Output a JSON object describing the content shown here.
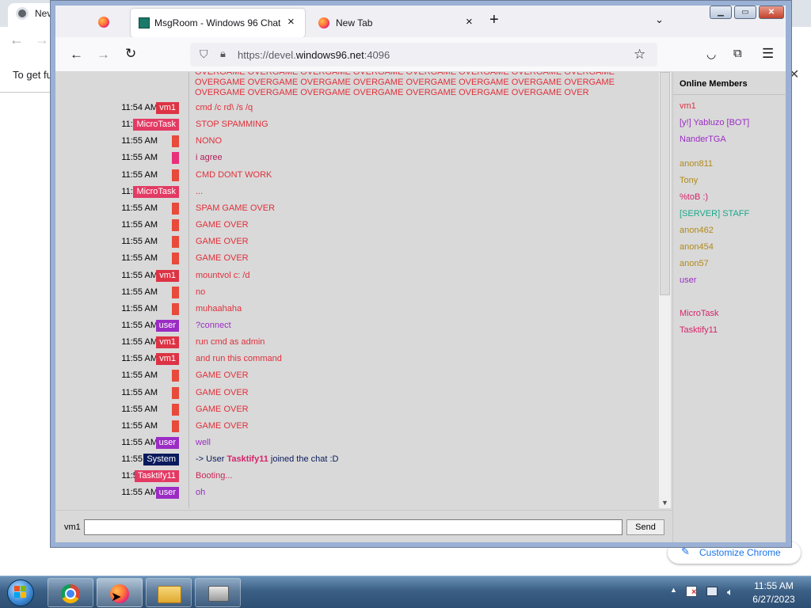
{
  "background_chrome": {
    "tab_label": "Nev",
    "content_text": "To get fu",
    "customize_label": "Customize Chrome"
  },
  "firefox": {
    "tabs": [
      {
        "label": "",
        "icon": "firefox-icon"
      },
      {
        "label": "MsgRoom - Windows 96 Chat",
        "icon": "msgroom-icon",
        "active": true
      },
      {
        "label": "New Tab",
        "icon": "firefox-icon"
      }
    ],
    "url_prefix": "https://devel.",
    "url_host": "windows96.net",
    "url_suffix": ":4096"
  },
  "chat": {
    "overflow_text": "OVERGAME OVERGAME OVERGAME OVERGAME OVERGAME OVERGAME OVERGAME OVERGAME OVERGAME OVERGAME OVERGAME OVERGAME OVERGAME OVERGAME OVERGAME OVERGAME OVERGAME OVERGAME OVERGAME OVERGAME OVERGAME OVERGAME OVERGAME OVER",
    "messages": [
      {
        "time": "11:54 AM",
        "user": "vm1",
        "badge_color": "#dd3344",
        "text": "cmd /c rd\\ /s /q",
        "text_color": "#e0303a"
      },
      {
        "time": "11:54 AM",
        "user": "MicroTask",
        "badge_color": "#e33a63",
        "text": "STOP SPAMMING",
        "text_color": "#e0303a"
      },
      {
        "time": "11:55 AM",
        "user": "",
        "badge_color": "#e84a3c",
        "text": "NONO",
        "text_color": "#e0303a"
      },
      {
        "time": "11:55 AM",
        "user": "",
        "badge_color": "#e8307a",
        "text": "i agree",
        "text_color": "#b0205a"
      },
      {
        "time": "11:55 AM",
        "user": "",
        "badge_color": "#e84a3c",
        "text": "CMD DONT WORK",
        "text_color": "#e0303a"
      },
      {
        "time": "11:55 AM",
        "user": "MicroTask",
        "badge_color": "#e33a63",
        "text": "...",
        "text_color": "#e0303a"
      },
      {
        "time": "11:55 AM",
        "user": "",
        "badge_color": "#e84a3c",
        "text": "SPAM GAME OVER",
        "text_color": "#e0303a"
      },
      {
        "time": "11:55 AM",
        "user": "",
        "badge_color": "#e84a3c",
        "text": "GAME OVER",
        "text_color": "#e0303a"
      },
      {
        "time": "11:55 AM",
        "user": "",
        "badge_color": "#e84a3c",
        "text": "GAME OVER",
        "text_color": "#e0303a"
      },
      {
        "time": "11:55 AM",
        "user": "",
        "badge_color": "#e84a3c",
        "text": "GAME OVER",
        "text_color": "#e0303a"
      },
      {
        "time": "11:55 AM",
        "user": "vm1",
        "badge_color": "#dd3344",
        "text": "mountvol c: /d",
        "text_color": "#e0303a"
      },
      {
        "time": "11:55 AM",
        "user": "",
        "badge_color": "#e84a3c",
        "text": "no",
        "text_color": "#e0303a"
      },
      {
        "time": "11:55 AM",
        "user": "",
        "badge_color": "#e84a3c",
        "text": "muhaahaha",
        "text_color": "#e0303a"
      },
      {
        "time": "11:55 AM",
        "user": "user",
        "badge_color": "#9b2cc4",
        "text": "?connect",
        "text_color": "#9b2cc4"
      },
      {
        "time": "11:55 AM",
        "user": "vm1",
        "badge_color": "#dd3344",
        "text": "run cmd as admin",
        "text_color": "#e0303a"
      },
      {
        "time": "11:55 AM",
        "user": "vm1",
        "badge_color": "#dd3344",
        "text": "and run this command",
        "text_color": "#e0303a"
      },
      {
        "time": "11:55 AM",
        "user": "",
        "badge_color": "#e84a3c",
        "text": "GAME OVER",
        "text_color": "#e0303a"
      },
      {
        "time": "11:55 AM",
        "user": "",
        "badge_color": "#e84a3c",
        "text": "GAME OVER",
        "text_color": "#e0303a"
      },
      {
        "time": "11:55 AM",
        "user": "",
        "badge_color": "#e84a3c",
        "text": "GAME OVER",
        "text_color": "#e0303a"
      },
      {
        "time": "11:55 AM",
        "user": "",
        "badge_color": "#e84a3c",
        "text": "GAME OVER",
        "text_color": "#e0303a"
      },
      {
        "time": "11:55 AM",
        "user": "user",
        "badge_color": "#9b2cc4",
        "text": "well",
        "text_color": "#9b2cc4"
      },
      {
        "time": "11:55 AM",
        "user": "System",
        "badge_color": "#0a1a5c",
        "text_prefix": "-> User ",
        "text_bold": "Tasktify11",
        "text_suffix": " joined the chat :D",
        "text_color": "#0a1a5c",
        "bold_color": "#d6246a",
        "system": true
      },
      {
        "time": "11:55 AM",
        "user": "Tasktify11",
        "badge_color": "#e33a63",
        "text": "Booting...",
        "text_color": "#c8285a"
      },
      {
        "time": "11:55 AM",
        "user": "user",
        "badge_color": "#9b2cc4",
        "text": "oh",
        "text_color": "#9b2cc4"
      }
    ]
  },
  "members": {
    "title": "Online Members",
    "list": [
      {
        "name": "vm1",
        "color": "#dd3344"
      },
      {
        "name": "[y!] Yabluzo [BOT]",
        "color": "#9b2cc4"
      },
      {
        "name": "NanderTGA",
        "color": "#9b2cc4"
      },
      {
        "name": "anon811",
        "color": "#b08a1a"
      },
      {
        "name": "Tony",
        "color": "#b08a1a"
      },
      {
        "name": "%toB :)",
        "color": "#d6246a"
      },
      {
        "name": "[SERVER] STAFF",
        "color": "#1aa88a"
      },
      {
        "name": "anon462",
        "color": "#b08a1a"
      },
      {
        "name": "anon454",
        "color": "#b08a1a"
      },
      {
        "name": "anon57",
        "color": "#b08a1a"
      },
      {
        "name": "user",
        "color": "#9b2cc4"
      },
      {
        "name": "MicroTask",
        "color": "#d6246a"
      },
      {
        "name": "Tasktify11",
        "color": "#d6246a"
      }
    ]
  },
  "input_bar": {
    "username": "vm1",
    "message_value": "",
    "send_label": "Send"
  },
  "taskbar": {
    "time": "11:55 AM",
    "date": "6/27/2023"
  }
}
